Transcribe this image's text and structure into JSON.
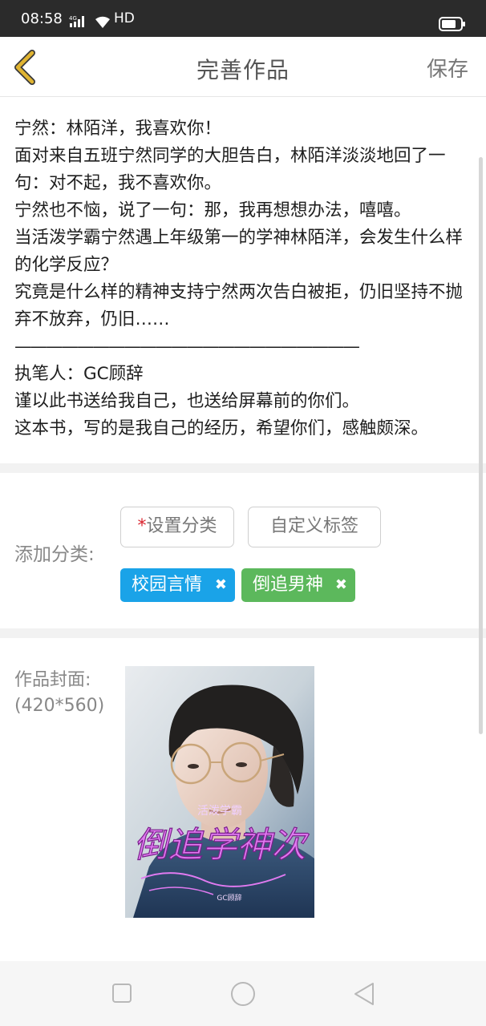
{
  "status_bar": {
    "time": "08:58",
    "network": "4G",
    "hd": "HD"
  },
  "header": {
    "title": "完善作品",
    "save_label": "保存"
  },
  "description": {
    "lines": [
      "宁然：林陌洋，我喜欢你！",
      "面对来自五班宁然同学的大胆告白，林陌洋淡淡地回了一句：对不起，我不喜欢你。",
      "宁然也不恼，说了一句：那，我再想想办法，嘻嘻。",
      "当活泼学霸宁然遇上年级第一的学神林陌洋，会发生什么样的化学反应？",
      "究竟是什么样的精神支持宁然两次告白被拒，仍旧坚持不抛弃不放弃，仍旧……",
      "——————————————————————",
      "执笔人：GC顾辞",
      "谨以此书送给我自己，也送给屏幕前的你们。",
      "这本书，写的是我自己的经历，希望你们，感触颇深。"
    ]
  },
  "category": {
    "label": "添加分类:",
    "required_mark": "*",
    "set_category_label": "设置分类",
    "custom_tag_label": "自定义标签",
    "tags": [
      {
        "label": "校园言情",
        "color": "#1aa3e8"
      },
      {
        "label": "倒追男神",
        "color": "#5cb85c"
      }
    ],
    "remove_glyph": "✖"
  },
  "cover": {
    "label": "作品封面:",
    "size_hint": "(420*560)",
    "art_top_text": "活泼学霸",
    "art_title": "倒追学神次",
    "art_author": "GC顾辞"
  },
  "colors": {
    "accent_back": "#e0b431",
    "tag_blue": "#1aa3e8",
    "tag_green": "#5cb85c",
    "required": "#d9232d"
  },
  "icons": {
    "back": "chevron-left-icon",
    "recent": "square-icon",
    "home": "circle-icon",
    "back_nav": "triangle-left-icon"
  }
}
